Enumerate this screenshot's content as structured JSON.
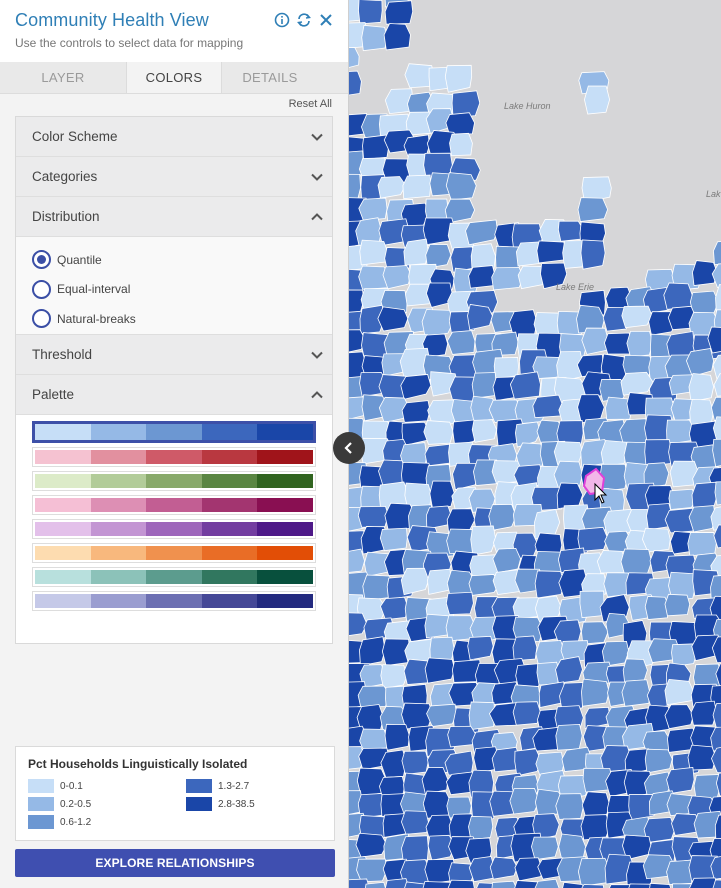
{
  "header": {
    "title": "Community Health View",
    "subtitle": "Use the controls to select data for mapping"
  },
  "icons": {
    "info": "info-icon",
    "refresh": "refresh-icon",
    "close": "close-icon"
  },
  "tabs": [
    {
      "label": "LAYER",
      "active": false
    },
    {
      "label": "COLORS",
      "active": true
    },
    {
      "label": "DETAILS",
      "active": false
    }
  ],
  "reset_label": "Reset All",
  "sections": {
    "color_scheme": "Color Scheme",
    "categories": "Categories",
    "distribution": "Distribution",
    "threshold": "Threshold",
    "palette": "Palette"
  },
  "distribution_options": [
    {
      "label": "Quantile",
      "selected": true
    },
    {
      "label": "Equal-interval",
      "selected": false
    },
    {
      "label": "Natural-breaks",
      "selected": false
    }
  ],
  "palettes": [
    {
      "selected": true,
      "colors": [
        "#c6def7",
        "#95b9e6",
        "#6c97d2",
        "#3c67bd",
        "#1a46a8"
      ]
    },
    {
      "selected": false,
      "colors": [
        "#f5c2d1",
        "#e2909f",
        "#cf5a68",
        "#b93840",
        "#a0141a"
      ]
    },
    {
      "selected": false,
      "colors": [
        "#dcebc8",
        "#b2cc99",
        "#88a96a",
        "#5a8642",
        "#316420"
      ]
    },
    {
      "selected": false,
      "colors": [
        "#f5bfd5",
        "#dd8fb4",
        "#c25e93",
        "#a33570",
        "#890f52"
      ]
    },
    {
      "selected": false,
      "colors": [
        "#e3c0ea",
        "#c395d3",
        "#9e66bb",
        "#733da0",
        "#4e1988"
      ]
    },
    {
      "selected": false,
      "colors": [
        "#fddcb0",
        "#f8b87d",
        "#f0914e",
        "#e96d26",
        "#e24e06"
      ]
    },
    {
      "selected": false,
      "colors": [
        "#b8e0dd",
        "#8cc2b9",
        "#5c9c8e",
        "#31775f",
        "#08503d"
      ]
    },
    {
      "selected": false,
      "colors": [
        "#c5c9e8",
        "#9a9dd0",
        "#6c6fb2",
        "#454897",
        "#232a7f"
      ]
    }
  ],
  "legend": {
    "title": "Pct Households Linguistically Isolated",
    "items": [
      {
        "label": "0-0.1",
        "color": "#c6def7"
      },
      {
        "label": "0.2-0.5",
        "color": "#95b9e6"
      },
      {
        "label": "0.6-1.2",
        "color": "#6c97d2"
      },
      {
        "label": "1.3-2.7",
        "color": "#3c67bd"
      },
      {
        "label": "2.8-38.5",
        "color": "#1a46a8"
      }
    ]
  },
  "explore_label": "EXPLORE RELATIONSHIPS",
  "map": {
    "lakes": [
      "Lake Huron",
      "Lake Erie",
      "Lak"
    ],
    "highlight_color": "#e040d8",
    "land_color": "#d6d6d8"
  }
}
